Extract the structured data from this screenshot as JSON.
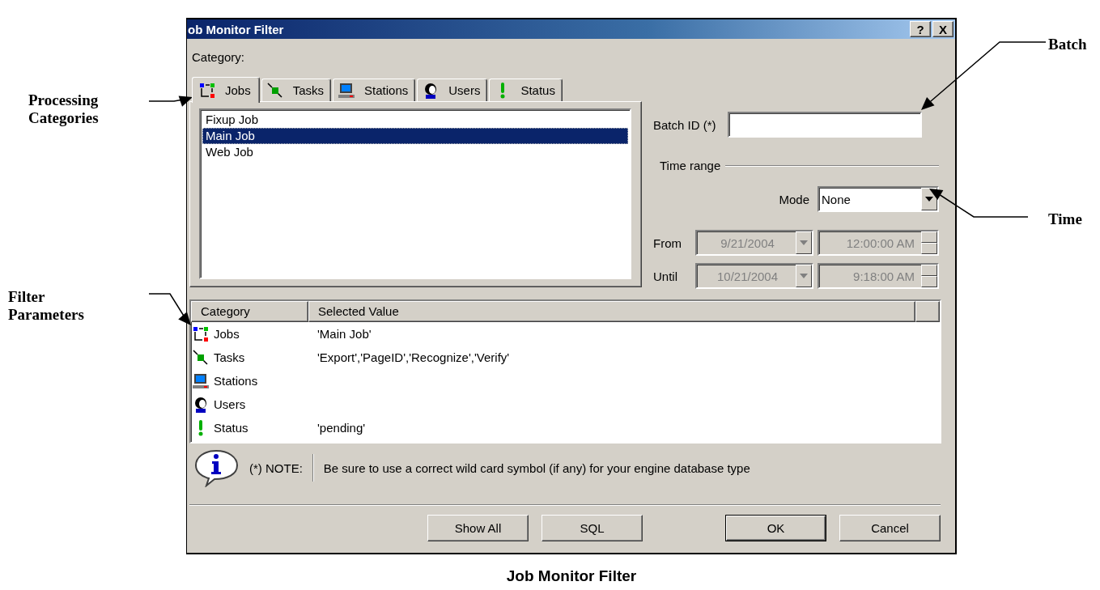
{
  "window": {
    "title": "ob Monitor Filter",
    "buttons": [
      {
        "label": "?"
      },
      {
        "label": "X"
      }
    ]
  },
  "category_label": "Category:",
  "tabs": [
    {
      "kind": "jobs",
      "label": "Jobs",
      "selected": true
    },
    {
      "kind": "tasks",
      "label": "Tasks",
      "selected": false
    },
    {
      "kind": "stations",
      "label": "Stations",
      "selected": false
    },
    {
      "kind": "users",
      "label": "Users",
      "selected": false
    },
    {
      "kind": "status",
      "label": "Status",
      "selected": false
    }
  ],
  "list": {
    "items": [
      {
        "label": "Fixup Job",
        "selected": false
      },
      {
        "label": "Main Job",
        "selected": true
      },
      {
        "label": "Web Job",
        "selected": false
      }
    ]
  },
  "batch_id": {
    "label": "Batch ID (*)"
  },
  "time_range": {
    "label": "Time range",
    "mode": {
      "label": "Mode",
      "value": "None"
    },
    "rows": [
      {
        "label": "From",
        "date": "9/21/2004",
        "time": "12:00:00 AM",
        "disabled": true
      },
      {
        "label": "Until",
        "date": "10/21/2004",
        "time": "9:18:00 AM",
        "disabled": true
      }
    ]
  },
  "filter_table": {
    "columns": [
      "Category",
      "Selected Value"
    ],
    "rows": [
      {
        "kind": "jobs",
        "category": "Jobs",
        "value": "'Main Job'"
      },
      {
        "kind": "tasks",
        "category": "Tasks",
        "value": "'Export','PageID','Recognize','Verify'"
      },
      {
        "kind": "stations",
        "category": "Stations"
      },
      {
        "kind": "users",
        "category": "Users"
      },
      {
        "kind": "status",
        "category": "Status",
        "value": "'pending'"
      }
    ]
  },
  "note": {
    "label": "(*) NOTE:",
    "text": "Be sure to use a correct wild card symbol (if any) for your engine database type"
  },
  "buttons": {
    "left": [
      {
        "label": "Show All",
        "default": false
      },
      {
        "label": "SQL",
        "default": false
      }
    ],
    "right": [
      {
        "label": "OK",
        "default": true
      },
      {
        "label": "Cancel",
        "default": false
      }
    ]
  },
  "annotations": [
    {
      "label": "Processing Categories"
    },
    {
      "label": "Filter Parameters"
    },
    {
      "label": "Batch"
    },
    {
      "label": "Time"
    }
  ],
  "caption": "Job Monitor Filter"
}
